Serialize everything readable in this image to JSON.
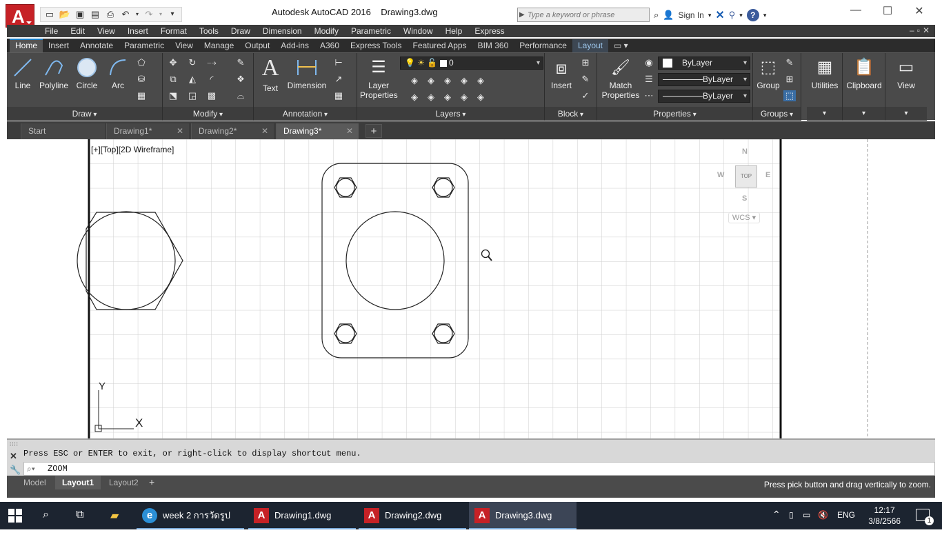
{
  "title_bar": {
    "window_title": "Autodesk AutoCAD 2016    Drawing3.dwg",
    "search_placeholder": "Type a keyword or phrase",
    "sign_in": "Sign In"
  },
  "menu": [
    "File",
    "Edit",
    "View",
    "Insert",
    "Format",
    "Tools",
    "Draw",
    "Dimension",
    "Modify",
    "Parametric",
    "Window",
    "Help",
    "Express"
  ],
  "ribbon_tabs": [
    {
      "label": "Home",
      "active": true
    },
    {
      "label": "Insert"
    },
    {
      "label": "Annotate"
    },
    {
      "label": "Parametric"
    },
    {
      "label": "View"
    },
    {
      "label": "Manage"
    },
    {
      "label": "Output"
    },
    {
      "label": "Add-ins"
    },
    {
      "label": "A360"
    },
    {
      "label": "Express Tools"
    },
    {
      "label": "Featured Apps"
    },
    {
      "label": "BIM 360"
    },
    {
      "label": "Performance"
    },
    {
      "label": "Layout"
    }
  ],
  "ribbon": {
    "draw": {
      "title": "Draw",
      "line": "Line",
      "polyline": "Polyline",
      "circle": "Circle",
      "arc": "Arc"
    },
    "modify": {
      "title": "Modify"
    },
    "annotation": {
      "title": "Annotation",
      "text": "Text",
      "dimension": "Dimension"
    },
    "layers": {
      "title": "Layers",
      "layer_properties_1": "Layer",
      "layer_properties_2": "Properties",
      "current_layer": "0"
    },
    "block": {
      "title": "Block",
      "insert": "Insert"
    },
    "properties": {
      "title": "Properties",
      "match_1": "Match",
      "match_2": "Properties",
      "color": "ByLayer",
      "linetype": "ByLayer",
      "lineweight": "ByLayer"
    },
    "groups": {
      "title": "Groups",
      "group": "Group"
    },
    "utilities": "Utilities",
    "clipboard": "Clipboard",
    "view": "View"
  },
  "file_tabs": [
    {
      "label": "Start"
    },
    {
      "label": "Drawing1*"
    },
    {
      "label": "Drawing2*"
    },
    {
      "label": "Drawing3*",
      "active": true
    }
  ],
  "viewport": {
    "label": "[+][Top][2D Wireframe]",
    "viewcube": {
      "n": "N",
      "s": "S",
      "e": "E",
      "w": "W",
      "top": "TOP",
      "wcs": "WCS"
    },
    "ucs": {
      "x": "X",
      "y": "Y"
    }
  },
  "command_line": {
    "history": "Press ESC or ENTER to exit, or right-click to display shortcut menu.",
    "input": "ZOOM"
  },
  "layout_tabs": [
    {
      "label": "Model"
    },
    {
      "label": "Layout1",
      "active": true
    },
    {
      "label": "Layout2"
    }
  ],
  "status_message": "Press pick button and drag vertically to zoom.",
  "taskbar": {
    "items": [
      {
        "label": "week 2 การวัดรูปเรขา..."
      },
      {
        "label": "Drawing1.dwg"
      },
      {
        "label": "Drawing2.dwg"
      },
      {
        "label": "Drawing3.dwg",
        "active": true
      }
    ],
    "language": "ENG",
    "time": "12:17",
    "date": "3/8/2566",
    "notifications": "1"
  },
  "colors": {
    "accent": "#1a7ec7",
    "autocad_red": "#c62126",
    "ribbon_bg": "#4a4a4a"
  }
}
